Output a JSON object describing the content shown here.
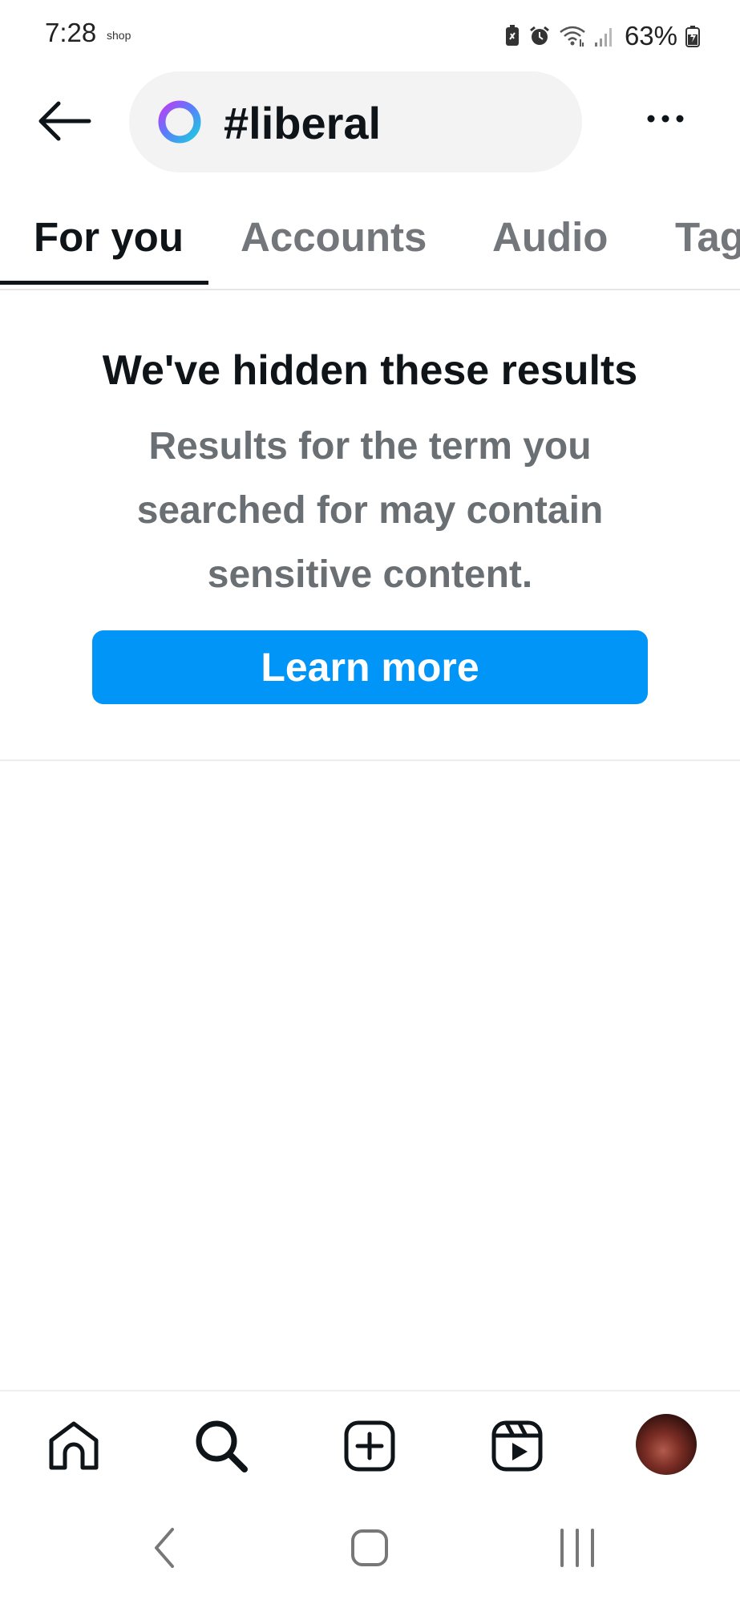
{
  "status_bar": {
    "time": "7:28",
    "notification_label": "shop",
    "battery": "63%"
  },
  "header": {
    "back_icon": "arrow-left-icon",
    "search_query": "#liberal",
    "hashtag_icon": "hashtag-ring-icon",
    "more_icon": "more-horizontal-icon"
  },
  "tabs": [
    {
      "label": "For you",
      "active": true
    },
    {
      "label": "Accounts",
      "active": false
    },
    {
      "label": "Audio",
      "active": false
    },
    {
      "label": "Tags",
      "active": false
    }
  ],
  "notice": {
    "title": "We've hidden these results",
    "body": "Results for the term you searched for may contain sensitive content.",
    "button_label": "Learn more"
  },
  "bottom_nav": [
    {
      "name": "home",
      "icon": "home-icon"
    },
    {
      "name": "search",
      "icon": "search-icon"
    },
    {
      "name": "create",
      "icon": "plus-square-icon"
    },
    {
      "name": "reels",
      "icon": "reels-icon"
    },
    {
      "name": "profile",
      "icon": "avatar"
    }
  ],
  "colors": {
    "accent": "#0095f6",
    "text_primary": "#0f1419",
    "text_secondary": "#6a6f74",
    "pill_background": "#f3f3f4"
  }
}
